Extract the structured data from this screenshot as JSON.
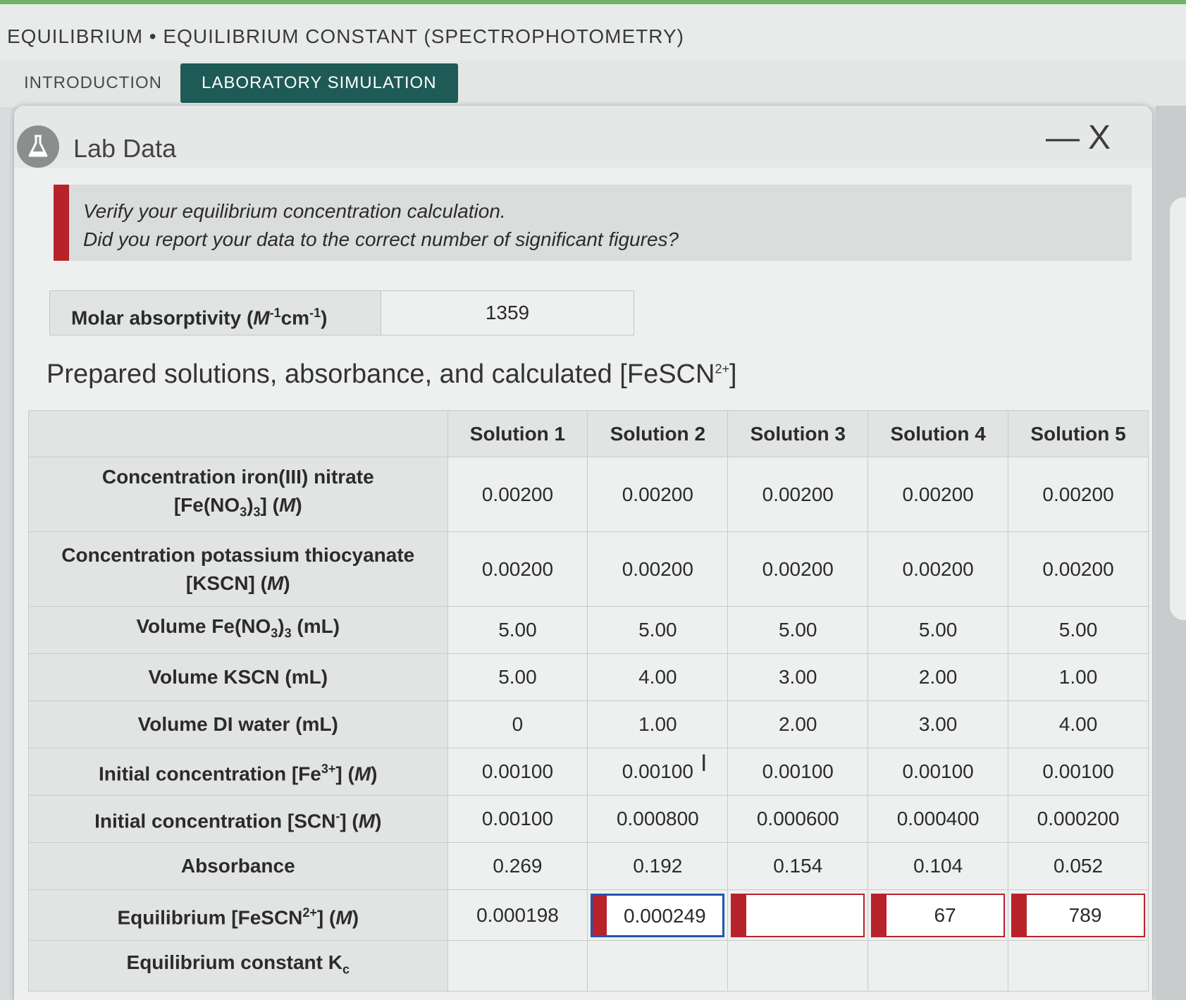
{
  "header": {
    "title": "EQUILIBRIUM • EQUILIBRIUM CONSTANT (SPECTROPHOTOMETRY)"
  },
  "tabs": [
    {
      "label": "INTRODUCTION",
      "active": false
    },
    {
      "label": "LABORATORY SIMULATION",
      "active": true
    }
  ],
  "panel": {
    "title": "Lab Data",
    "minimize": "—",
    "close": "X"
  },
  "alert": {
    "line1": "Verify your equilibrium concentration calculation.",
    "line2": "Did you report your data to the correct number of significant figures?",
    "color": "#b8222a"
  },
  "molar": {
    "label_prefix": "Molar absorptivity (",
    "label_unit_M": "M",
    "label_exp1": "-1",
    "label_unit_cm": "cm",
    "label_exp2": "-1",
    "label_suffix": ")",
    "value": "1359"
  },
  "section": {
    "title_prefix": "Prepared solutions, absorbance, and calculated [FeSCN",
    "title_sup": "2+",
    "title_suffix": "]"
  },
  "table": {
    "headers": [
      "Solution 1",
      "Solution 2",
      "Solution 3",
      "Solution 4",
      "Solution 5"
    ],
    "rows": {
      "fe_no3": {
        "label_line1": "Concentration iron(III) nitrate",
        "label_line2_a": "[Fe(NO",
        "label_line2_sub": "3",
        "label_line2_b": ")",
        "label_line2_sub2": "3",
        "label_line2_c": "] (",
        "label_line2_M": "M",
        "label_line2_d": ")",
        "values": [
          "0.00200",
          "0.00200",
          "0.00200",
          "0.00200",
          "0.00200"
        ]
      },
      "kscn": {
        "label_line1": "Concentration potassium thiocyanate",
        "label_line2_a": "[KSCN] (",
        "label_line2_M": "M",
        "label_line2_b": ")",
        "values": [
          "0.00200",
          "0.00200",
          "0.00200",
          "0.00200",
          "0.00200"
        ]
      },
      "vol_fe": {
        "label_a": "Volume Fe(NO",
        "label_sub": "3",
        "label_b": ")",
        "label_sub2": "3",
        "label_c": " (mL)",
        "values": [
          "5.00",
          "5.00",
          "5.00",
          "5.00",
          "5.00"
        ]
      },
      "vol_kscn": {
        "label": "Volume KSCN (mL)",
        "values": [
          "5.00",
          "4.00",
          "3.00",
          "2.00",
          "1.00"
        ]
      },
      "vol_water": {
        "label": "Volume DI water (mL)",
        "values": [
          "0",
          "1.00",
          "2.00",
          "3.00",
          "4.00"
        ]
      },
      "init_fe": {
        "label_a": "Initial concentration [Fe",
        "label_sup": "3+",
        "label_b": "] (",
        "label_M": "M",
        "label_c": ")",
        "values": [
          "0.00100",
          "0.00100",
          "0.00100",
          "0.00100",
          "0.00100"
        ]
      },
      "init_scn": {
        "label_a": "Initial concentration [SCN",
        "label_sup": "-",
        "label_b": "] (",
        "label_M": "M",
        "label_c": ")",
        "values": [
          "0.00100",
          "0.000800",
          "0.000600",
          "0.000400",
          "0.000200"
        ]
      },
      "absorbance": {
        "label": "Absorbance",
        "values": [
          "0.269",
          "0.192",
          "0.154",
          "0.104",
          "0.052"
        ]
      },
      "eq_fescn": {
        "label_a": "Equilibrium [FeSCN",
        "label_sup": "2+",
        "label_b": "] (",
        "label_M": "M",
        "label_c": ")",
        "value1": "0.000198",
        "inputs": [
          "0.000249",
          "",
          "67",
          "789"
        ]
      },
      "kc": {
        "label_a": "Equilibrium constant K",
        "label_sub": "c",
        "values": [
          "",
          "",
          "",
          "",
          ""
        ]
      }
    }
  },
  "cursor": "I"
}
